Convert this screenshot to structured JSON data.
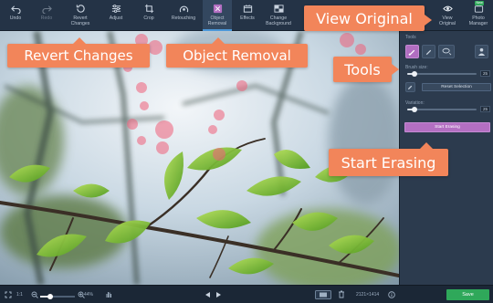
{
  "toolbar": {
    "items": [
      {
        "label": "Undo",
        "icon": "undo-icon"
      },
      {
        "label": "Redo",
        "icon": "redo-icon"
      },
      {
        "label": "Revert\nChanges",
        "icon": "revert-icon"
      },
      {
        "label": "Adjust",
        "icon": "sliders-icon"
      },
      {
        "label": "Crop",
        "icon": "crop-icon"
      },
      {
        "label": "Retouching",
        "icon": "retouch-icon"
      },
      {
        "label": "Object\nRemoval",
        "icon": "eraser-icon"
      },
      {
        "label": "Effects",
        "icon": "effects-icon"
      },
      {
        "label": "Change\nBackground",
        "icon": "background-icon"
      },
      {
        "label": "View\nOriginal",
        "icon": "eye-icon"
      },
      {
        "label": "Photo\nManager",
        "icon": "photo-manager-icon",
        "badge": "New"
      }
    ],
    "active": "Object Removal"
  },
  "panel": {
    "tools_label": "Tools",
    "brush_size_label": "Brush size:",
    "brush_size_value": "25",
    "brush_size_fraction": 0.1,
    "reset_selection_label": "Reset Selection",
    "variation_label": "Variation:",
    "variation_value": "25",
    "variation_fraction": 0.1,
    "start_erasing_label": "Start Erasing"
  },
  "status": {
    "fit_label": "1:1",
    "zoom_value": "44%",
    "image_size": "2121×1414",
    "save_label": "Save"
  },
  "callouts": {
    "revert": "Revert Changes",
    "object_removal": "Object Removal",
    "view_original": "View Original",
    "tools": "Tools",
    "start_erasing": "Start Erasing"
  },
  "colors": {
    "accent_purple": "#b36fc2",
    "callout_orange": "#f2855a",
    "save_green": "#2fa85a",
    "panel_bg": "#2c3b4e",
    "toolbar_bg": "#243346"
  }
}
